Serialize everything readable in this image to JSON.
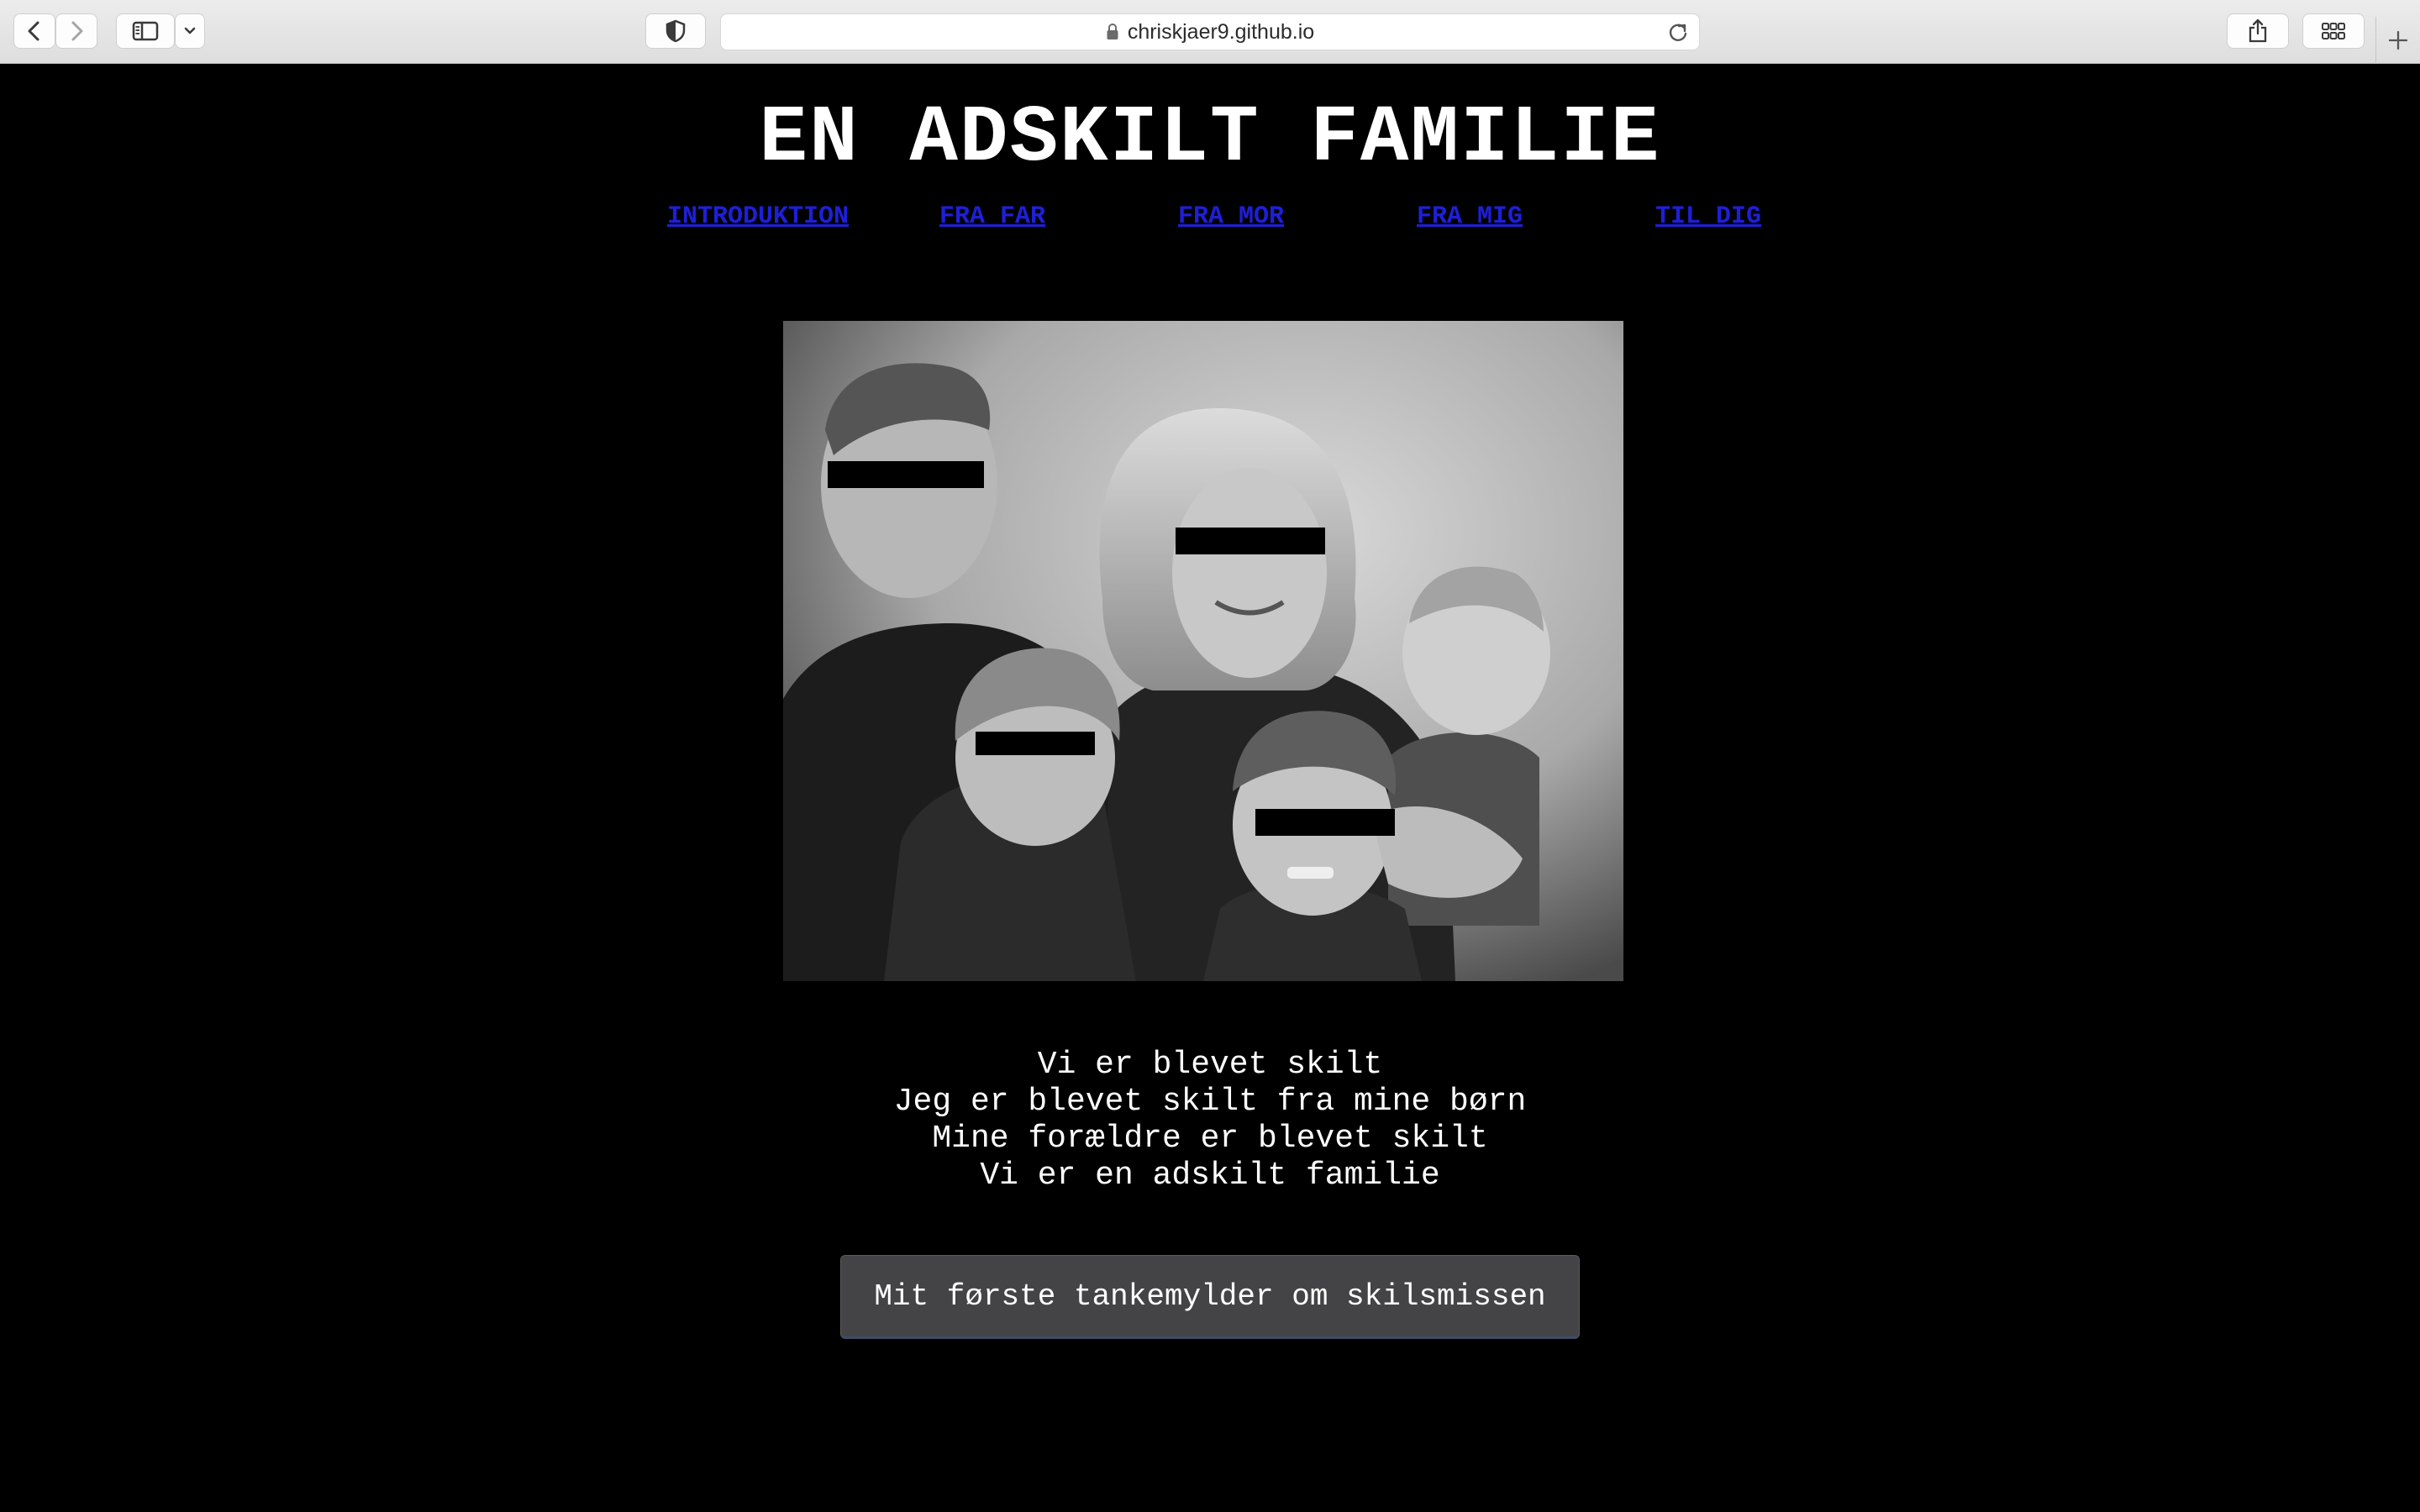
{
  "browser": {
    "url": "chriskjaer9.github.io",
    "toolbar_color": "#e4e4e4"
  },
  "site": {
    "title": "EN ADSKILT FAMILIE",
    "nav": [
      {
        "label": "INTRODUKTION"
      },
      {
        "label": "FRA FAR"
      },
      {
        "label": "FRA MOR"
      },
      {
        "label": "FRA MIG"
      },
      {
        "label": "TIL DIG"
      }
    ],
    "link_color": "#1f1fd8",
    "photo": {
      "description_icon": "family-photo-icon"
    },
    "poem": [
      "Vi er blevet skilt",
      "Jeg er blevet skilt fra mine børn",
      "Mine forældre er blevet skilt",
      "Vi er en adskilt familie"
    ],
    "cta_label": "Mit første tankemylder om skilsmissen"
  }
}
